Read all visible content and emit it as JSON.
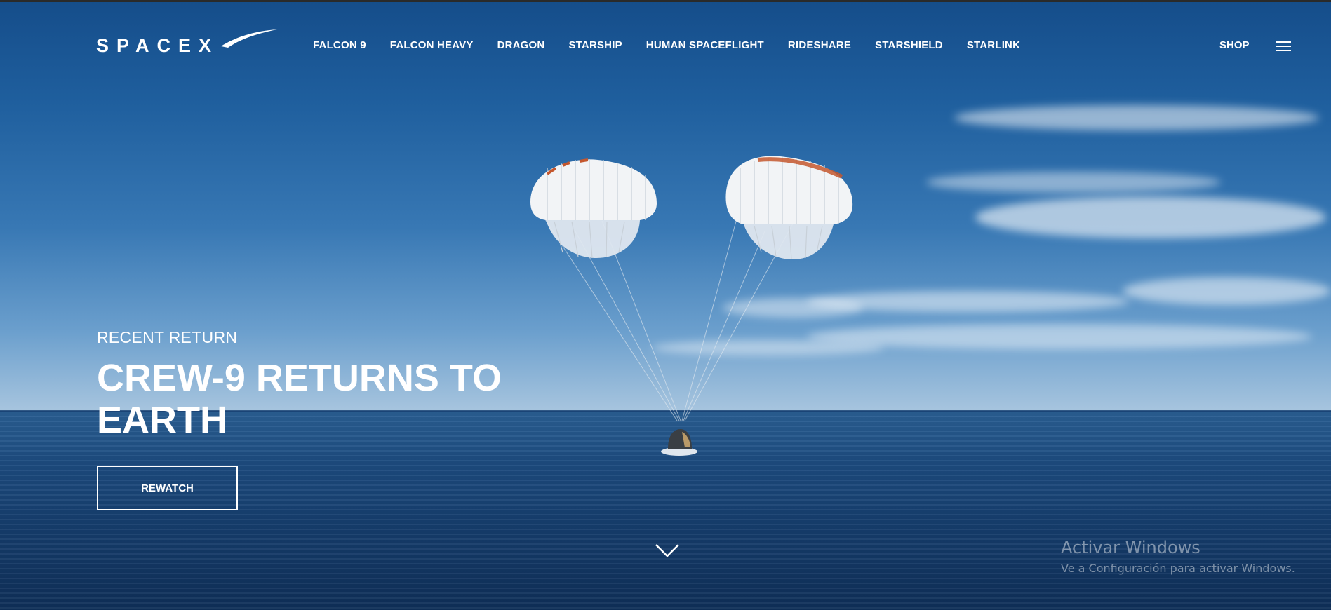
{
  "header": {
    "brand": "SPACEX",
    "nav": [
      "FALCON 9",
      "FALCON HEAVY",
      "DRAGON",
      "STARSHIP",
      "HUMAN SPACEFLIGHT",
      "RIDESHARE",
      "STARSHIELD",
      "STARLINK"
    ],
    "shop_label": "SHOP",
    "menu_icon": "hamburger-menu-icon"
  },
  "hero": {
    "eyebrow": "RECENT RETURN",
    "headline": "CREW-9 RETURNS TO EARTH",
    "cta_label": "REWATCH",
    "scroll_icon": "chevron-down-icon"
  },
  "watermark": {
    "title": "Activar Windows",
    "subtitle": "Ve a Configuración para activar Windows."
  },
  "colors": {
    "sky_top": "#154d8a",
    "ocean": "#163e6e",
    "text": "#ffffff",
    "chute_stripe": "#c4572e"
  }
}
